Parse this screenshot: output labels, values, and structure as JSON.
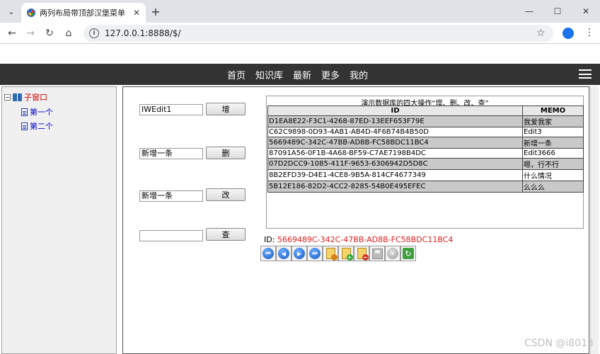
{
  "browser": {
    "tab_title": "两列布局带顶部汉堡菜单",
    "url": "127.0.0.1:8888/$/"
  },
  "navbar": {
    "items": [
      "首页",
      "知识库",
      "最新",
      "更多",
      "我的"
    ]
  },
  "tree": {
    "root_label": "子窗口",
    "children": [
      "第一个",
      "第二个"
    ]
  },
  "form": {
    "rows": [
      {
        "input_value": "IWEdit1",
        "button_label": "增"
      },
      {
        "input_value": "新增一条",
        "button_label": "删"
      },
      {
        "input_value": "新增一条",
        "button_label": "改"
      },
      {
        "input_value": "",
        "button_label": "查"
      }
    ]
  },
  "grid": {
    "caption": "演示数据库的四大操作“增、删、改、查”",
    "columns": [
      "ID",
      "MEMO"
    ],
    "rows": [
      {
        "id": "D1EA8E22-F3C1-4268-87ED-13EEF653F79E",
        "memo": "我爱我家"
      },
      {
        "id": "C62C9898-0D93-4AB1-AB4D-4F6B74B4B50D",
        "memo": "Edit3"
      },
      {
        "id": "5669489C-342C-47BB-AD8B-FC58BDC11BC4",
        "memo": "新增一条"
      },
      {
        "id": "87091A56-0F1B-4A68-BF59-C7AE7198B4DC",
        "memo": "Edit3666"
      },
      {
        "id": "07D2DCC9-1085-411F-9653-6306942D5D8C",
        "memo": "嗯，行不行"
      },
      {
        "id": "8B2EFD39-D4E1-4CE8-9B5A-814CF4677349",
        "memo": "什么情况"
      },
      {
        "id": "5B12E186-82D2-4CC2-8285-54B0E495EFEC",
        "memo": "么么么"
      }
    ]
  },
  "current": {
    "label": "ID:",
    "value": "5669489C-342C-47BB-AD8B-FC58BDC11BC4"
  },
  "watermark": "CSDN @i8013",
  "colors": {
    "navbar_bg": "#333333",
    "id_value": "#e02020",
    "tree_root": "#cc0000",
    "tree_child": "#0000cc"
  }
}
